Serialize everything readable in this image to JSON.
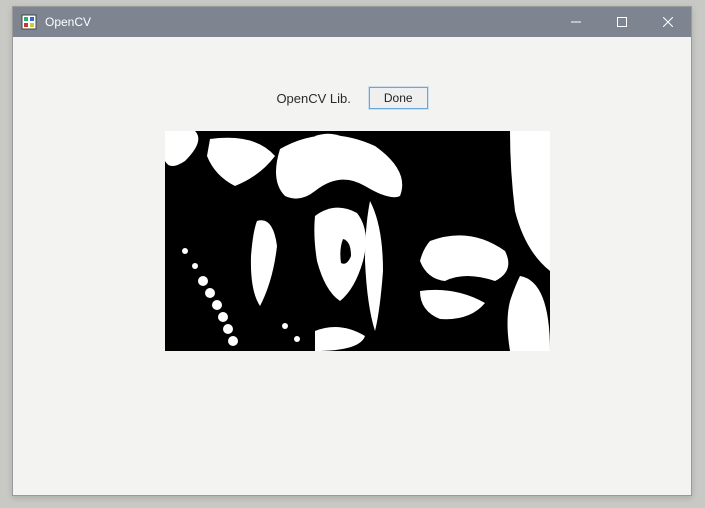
{
  "window": {
    "title": "OpenCV"
  },
  "controls": {
    "label": "OpenCV Lib.",
    "done_button": "Done"
  }
}
